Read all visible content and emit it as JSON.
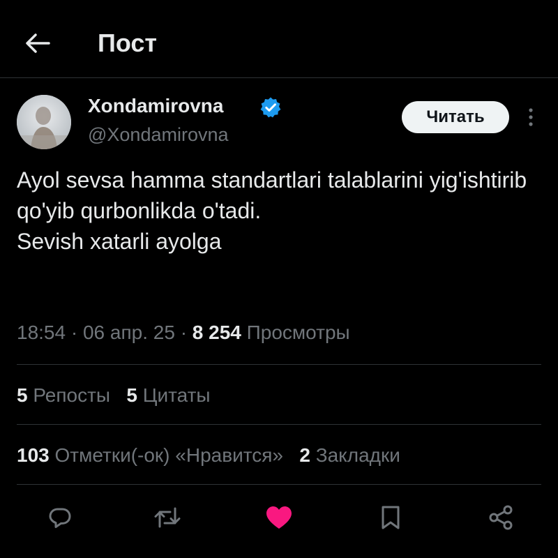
{
  "header": {
    "title": "Пост"
  },
  "author": {
    "name": "Xondamirovna",
    "handle": "@Xondamirovna",
    "verified": true
  },
  "follow_button": {
    "label": "Читать"
  },
  "tweet": {
    "text": "Ayol sevsa hamma standartlari talablarini yig'ishtirib qo'yib qurbonlikda o'tadi.\nSevish xatarli ayolga"
  },
  "meta": {
    "time": "18:54",
    "date": "06 апр. 25",
    "separator": "·",
    "views_count": "8 254",
    "views_label": "Просмотры"
  },
  "stats": {
    "reposts_count": "5",
    "reposts_label": "Репосты",
    "quotes_count": "5",
    "quotes_label": "Цитаты",
    "likes_count": "103",
    "likes_label": "Отметки(-ок) «Нравится»",
    "bookmarks_count": "2",
    "bookmarks_label": "Закладки"
  },
  "actions": [
    "reply-icon",
    "retweet-icon",
    "like-icon",
    "bookmark-icon",
    "share-icon"
  ],
  "colors": {
    "background": "#000000",
    "text": "#e7e9ea",
    "secondary": "#71767b",
    "divider": "#2f3336",
    "verified": "#1d9bf0",
    "like": "#f91880",
    "follow_bg": "#eff3f4"
  }
}
